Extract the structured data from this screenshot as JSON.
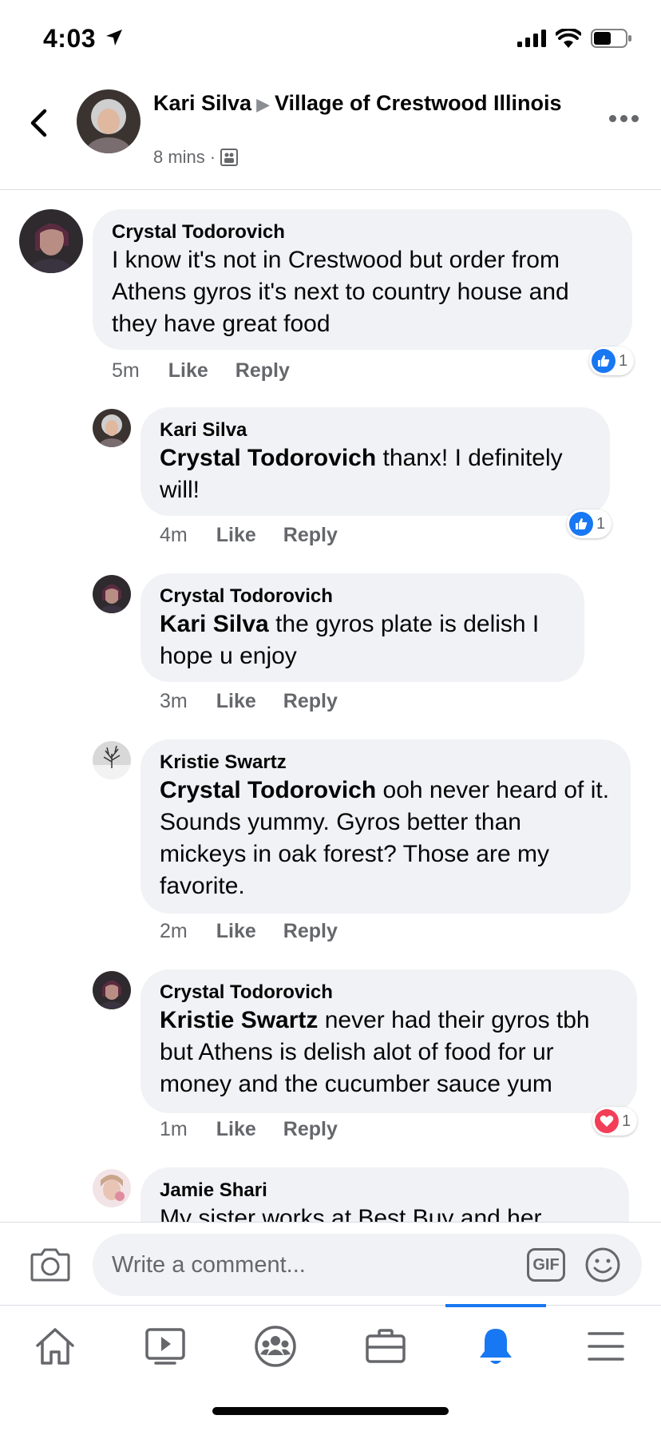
{
  "status_bar": {
    "time": "4:03",
    "battery_level": 0.55
  },
  "header": {
    "author": "Kari Silva",
    "group": "Village of Crestwood Illinois",
    "time": "8 mins",
    "privacy_icon": "group-members-icon"
  },
  "comments": [
    {
      "author": "Crystal Todorovich",
      "mention": "",
      "text": "I know it's not in Crestwood but order from Athens gyros it's next to country house and they have great food",
      "time": "5m",
      "like": "Like",
      "reply": "Reply",
      "reaction": {
        "type": "like",
        "count": "1"
      }
    },
    {
      "author": "Kari Silva",
      "mention": "Crystal Todorovich",
      "text": "thanx! I definitely will!",
      "time": "4m",
      "like": "Like",
      "reply": "Reply",
      "reaction": {
        "type": "like",
        "count": "1"
      }
    },
    {
      "author": "Crystal Todorovich",
      "mention": "Kari Silva",
      "text": "the gyros plate is delish I hope u enjoy",
      "time": "3m",
      "like": "Like",
      "reply": "Reply"
    },
    {
      "author": "Kristie Swartz",
      "mention": "Crystal Todorovich",
      "text": "ooh never heard of it. Sounds yummy. Gyros better than mickeys in oak forest? Those are my favorite.",
      "time": "2m",
      "like": "Like",
      "reply": "Reply"
    },
    {
      "author": "Crystal Todorovich",
      "mention": "Kristie Swartz",
      "text": "never had their gyros tbh but Athens is delish alot of food for ur money and the cucumber sauce yum",
      "time": "1m",
      "like": "Like",
      "reply": "Reply",
      "reaction": {
        "type": "love",
        "count": "1"
      }
    },
    {
      "author": "Jamie Shari",
      "mention": "",
      "text": "My sister works at Best Buy and her"
    }
  ],
  "composer": {
    "placeholder": "Write a comment...",
    "gif_label": "GIF"
  },
  "tabs": [
    {
      "icon": "home-icon",
      "active": false
    },
    {
      "icon": "watch-icon",
      "active": false
    },
    {
      "icon": "groups-icon",
      "active": false
    },
    {
      "icon": "marketplace-icon",
      "active": false
    },
    {
      "icon": "notifications-icon",
      "active": true
    },
    {
      "icon": "menu-icon",
      "active": false
    }
  ],
  "colors": {
    "accent": "#1877f2",
    "love": "#f33e58",
    "bubble": "#f0f2f5",
    "secondary_text": "#65676b"
  }
}
